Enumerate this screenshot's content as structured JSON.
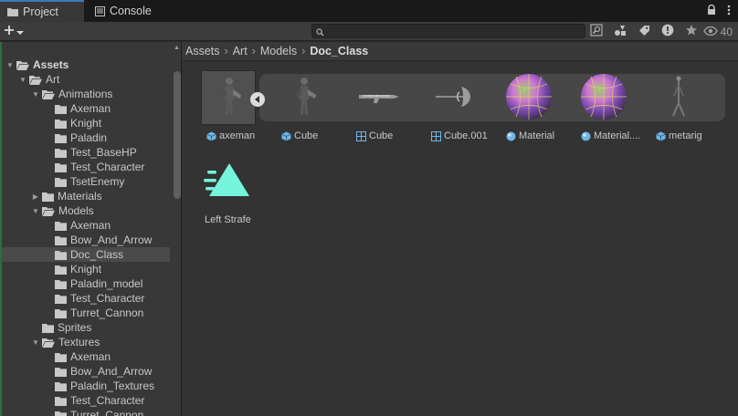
{
  "tabs": [
    {
      "label": "Project",
      "icon": "folder-icon",
      "active": true
    },
    {
      "label": "Console",
      "icon": "console-icon",
      "active": false
    }
  ],
  "toolbar": {
    "add_label": "+",
    "search_placeholder": "",
    "hidden_count": "40"
  },
  "tree": {
    "items": [
      {
        "label": "Assets",
        "depth": 0,
        "expanded": true,
        "bold": true
      },
      {
        "label": "Art",
        "depth": 1,
        "expanded": true
      },
      {
        "label": "Animations",
        "depth": 2,
        "expanded": true
      },
      {
        "label": "Axeman",
        "depth": 3
      },
      {
        "label": "Knight",
        "depth": 3
      },
      {
        "label": "Paladin",
        "depth": 3
      },
      {
        "label": "Test_BaseHP",
        "depth": 3
      },
      {
        "label": "Test_Character",
        "depth": 3
      },
      {
        "label": "TsetEnemy",
        "depth": 3
      },
      {
        "label": "Materials",
        "depth": 2,
        "expanded": false
      },
      {
        "label": "Models",
        "depth": 2,
        "expanded": true
      },
      {
        "label": "Axeman",
        "depth": 3
      },
      {
        "label": "Bow_And_Arrow",
        "depth": 3
      },
      {
        "label": "Doc_Class",
        "depth": 3,
        "selected": true
      },
      {
        "label": "Knight",
        "depth": 3
      },
      {
        "label": "Paladin_model",
        "depth": 3
      },
      {
        "label": "Test_Character",
        "depth": 3
      },
      {
        "label": "Turret_Cannon",
        "depth": 3
      },
      {
        "label": "Sprites",
        "depth": 2
      },
      {
        "label": "Textures",
        "depth": 2,
        "expanded": true
      },
      {
        "label": "Axeman",
        "depth": 3
      },
      {
        "label": "Bow_And_Arrow",
        "depth": 3
      },
      {
        "label": "Paladin_Textures",
        "depth": 3
      },
      {
        "label": "Test_Character",
        "depth": 3
      },
      {
        "label": "Turret_Cannon",
        "depth": 3
      }
    ]
  },
  "breadcrumb": [
    "Assets",
    "Art",
    "Models",
    "Doc_Class"
  ],
  "assets": [
    {
      "label": "axeman",
      "type": "prefab",
      "thumb": "figure"
    },
    {
      "label": "Cube",
      "type": "prefab",
      "thumb": "figure"
    },
    {
      "label": "Cube",
      "type": "mesh",
      "thumb": "rifle"
    },
    {
      "label": "Cube.001",
      "type": "mesh",
      "thumb": "axe"
    },
    {
      "label": "Material",
      "type": "material",
      "thumb": "sphere"
    },
    {
      "label": "Material....",
      "type": "material",
      "thumb": "sphere"
    },
    {
      "label": "metarig",
      "type": "prefab",
      "thumb": "rig"
    }
  ],
  "assets2": [
    {
      "label": "Left Strafe",
      "type": "animation"
    }
  ],
  "colors": {
    "accent": "#3a79bb",
    "anim_teal": "#74f5dc",
    "prefab_blue": "#6fb6e8"
  }
}
